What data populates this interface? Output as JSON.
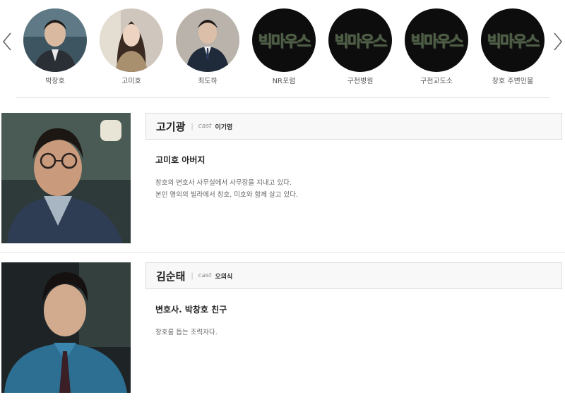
{
  "carousel": {
    "items": [
      {
        "label": "박창호",
        "type": "photo"
      },
      {
        "label": "고미호",
        "type": "photo"
      },
      {
        "label": "최도하",
        "type": "photo"
      },
      {
        "label": "NR포럼",
        "type": "logo"
      },
      {
        "label": "구천병원",
        "type": "logo"
      },
      {
        "label": "구천교도소",
        "type": "logo"
      },
      {
        "label": "창호 주변인물",
        "type": "logo"
      }
    ],
    "logo_text": "빅마우스",
    "icons": {
      "prev": "chevron-left-icon",
      "next": "chevron-right-icon"
    }
  },
  "characters": [
    {
      "name": "고기광",
      "cast_label": "cast",
      "actor": "이기영",
      "role": "고미호 아버지",
      "description": [
        "창호의 변호사 사무실에서 사무장을 지내고 있다.",
        "본인 명의의 빌라에서 창호, 미호와 함께 살고 있다."
      ]
    },
    {
      "name": "김순태",
      "cast_label": "cast",
      "actor": "오의식",
      "role": "변호사. 박창호 친구",
      "description": [
        "창호를 돕는 조력자다."
      ]
    }
  ],
  "colors": {
    "logo_bg": "#0d0d0d",
    "logo_text": "#4e5e46",
    "name_bar_bg": "#f8f8f8"
  }
}
